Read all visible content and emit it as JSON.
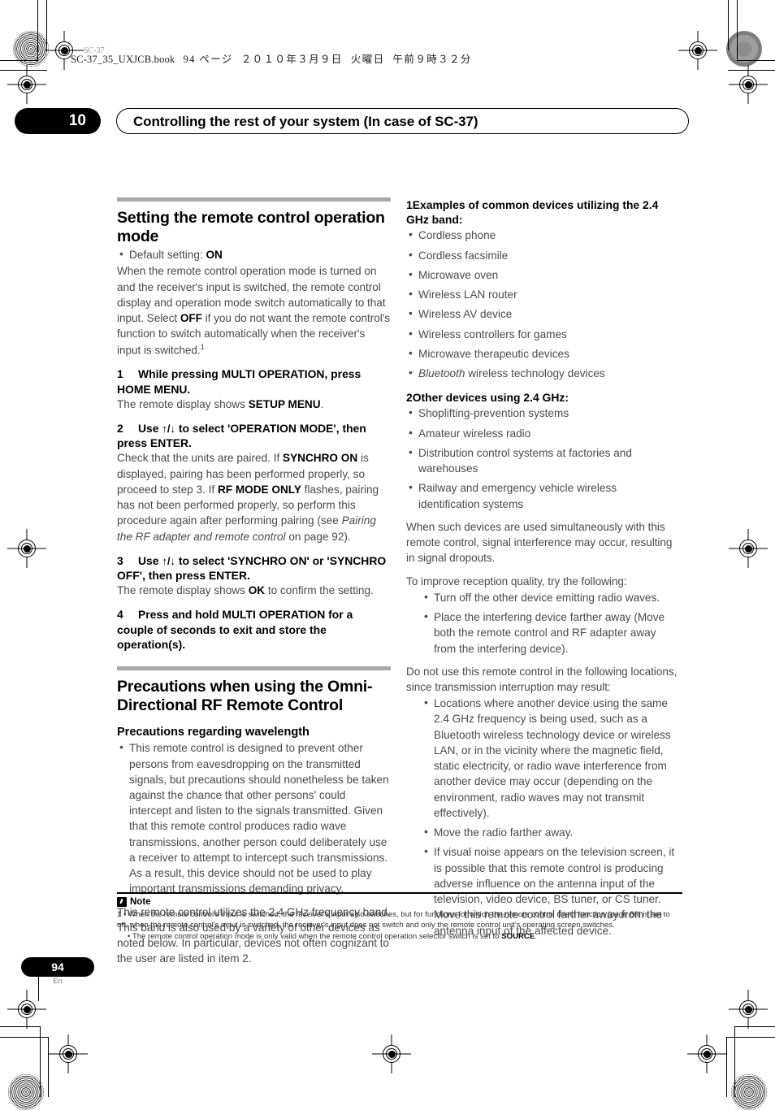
{
  "print_marks": {
    "corner_label": "SC-37"
  },
  "book_header": {
    "filename": "SC-37_35_UXJCB.book",
    "page_label": "94 ページ",
    "date": "２０１０年３月９日",
    "weekday": "火曜日",
    "time": "午前９時３２分"
  },
  "chapter": {
    "number": "10",
    "title": "Controlling the rest of your system (In case of SC-37)"
  },
  "left_column": {
    "section1": {
      "heading": "Setting the remote control operation mode",
      "default_bullet_label": "Default setting:",
      "default_bullet_value": "ON",
      "intro_part1": "When the remote control operation mode is turned on and the receiver's input is switched, the remote control display and operation mode switch automatically to that input. Select ",
      "intro_off": "OFF",
      "intro_part2": " if you do not want the remote control's function to switch automatically when the receiver's input is switched.",
      "intro_footnote": "1",
      "steps": [
        {
          "number": "1",
          "title": "While pressing MULTI OPERATION, press HOME MENU.",
          "body_pre": "The remote display shows ",
          "body_bold": "SETUP MENU",
          "body_post": "."
        },
        {
          "number": "2",
          "title_pre": "Use ",
          "title_arrows": "↑/↓",
          "title_post": " to select 'OPERATION MODE', then press ENTER.",
          "body_1": "Check that the units are paired. If ",
          "body_b1": "SYNCHRO ON",
          "body_2": " is displayed, pairing has been performed properly, so proceed to step 3. If ",
          "body_b2": "RF MODE ONLY",
          "body_3": " flashes, pairing has not been performed properly, so perform this procedure again after performing pairing (see ",
          "body_italic": "Pairing the RF adapter and remote control",
          "body_4": " on page 92)."
        },
        {
          "number": "3",
          "title_pre": "Use ",
          "title_arrows": "↑/↓",
          "title_post": " to select 'SYNCHRO ON' or 'SYNCHRO OFF', then press ENTER.",
          "body_pre": "The remote display shows ",
          "body_bold": "OK",
          "body_post": " to confirm the setting."
        },
        {
          "number": "4",
          "title": "Press and hold MULTI OPERATION for a couple of seconds to exit and store the operation(s)."
        }
      ]
    },
    "section2": {
      "heading": "Precautions when using the Omni-Directional RF Remote Control",
      "subheading": "Precautions regarding wavelength",
      "bullets": [
        "This remote control is designed to prevent other persons from eavesdropping on the transmitted signals, but precautions should nonetheless be taken against the chance that other persons' could intercept and listen to the signals transmitted. Given that this remote control produces radio wave transmissions, another person could deliberately use a receiver to attempt to intercept such transmissions. As a result, this device should not be used to play important transmissions demanding privacy."
      ],
      "closing_paragraph": "This remote control utilizes the 2.4 GHz frequency band. This band is also used by a variety of other devices as noted below. In particular, devices not often cognizant to the user are listed in item 2."
    }
  },
  "right_column": {
    "item1": {
      "number": "1",
      "title": "Examples of common devices utilizing the 2.4 GHz band:",
      "bullets": [
        "Cordless phone",
        "Cordless facsimile",
        "Microwave oven",
        "Wireless LAN router",
        "Wireless AV device",
        "Wireless controllers for games",
        "Microwave therapeutic devices"
      ],
      "bluetooth_italic": "Bluetooth",
      "bluetooth_rest": " wireless technology devices"
    },
    "item2": {
      "number": "2",
      "title": "Other devices using 2.4 GHz:",
      "bullets": [
        "Shoplifting-prevention systems",
        "Amateur wireless radio",
        "Distribution control systems at factories and warehouses",
        "Railway and emergency vehicle wireless identification systems"
      ]
    },
    "interference_paragraph": "When such devices are used simultaneously with this remote control, signal interference may occur, resulting in signal dropouts.",
    "improve_intro": "To improve reception quality, try the following:",
    "improve_bullets": [
      "Turn off the other device emitting radio waves.",
      "Place the interfering device farther away (Move both the remote control and RF adapter away from the interfering device)."
    ],
    "avoid_intro": "Do not use this remote control in the following locations, since transmission interruption may result:",
    "avoid_bullets": [
      "Locations where another device using the same 2.4 GHz frequency is being used, such as a Bluetooth wireless technology device or wireless LAN, or in the vicinity where the magnetic field, static electricity, or radio wave interference from another device may occur (depending on the environment, radio waves may not transmit effectively).",
      "Move the radio farther away.",
      "If visual noise appears on the television screen, it is possible that this remote control is producing adverse influence on the antenna input of the television, video device, BS tuner, or CS tuner. Move this remote control farther away from the antenna input of the affected device."
    ]
  },
  "note": {
    "title": "Note",
    "num": "1",
    "line1": "When the remote control's input is switched, the receiver's input also switches, but for functions for which the remote control direct function (page 86) is set to off, when the remote control's input is switched, the receiver's input does not switch and only the remote control unit's operating screen switches.",
    "line2_pre": "The remote control operation mode is only valid when the remote control operation selector switch is set to ",
    "line2_bold": "SOURCE",
    "line2_post": "."
  },
  "footer": {
    "page_number": "94",
    "language": "En"
  }
}
